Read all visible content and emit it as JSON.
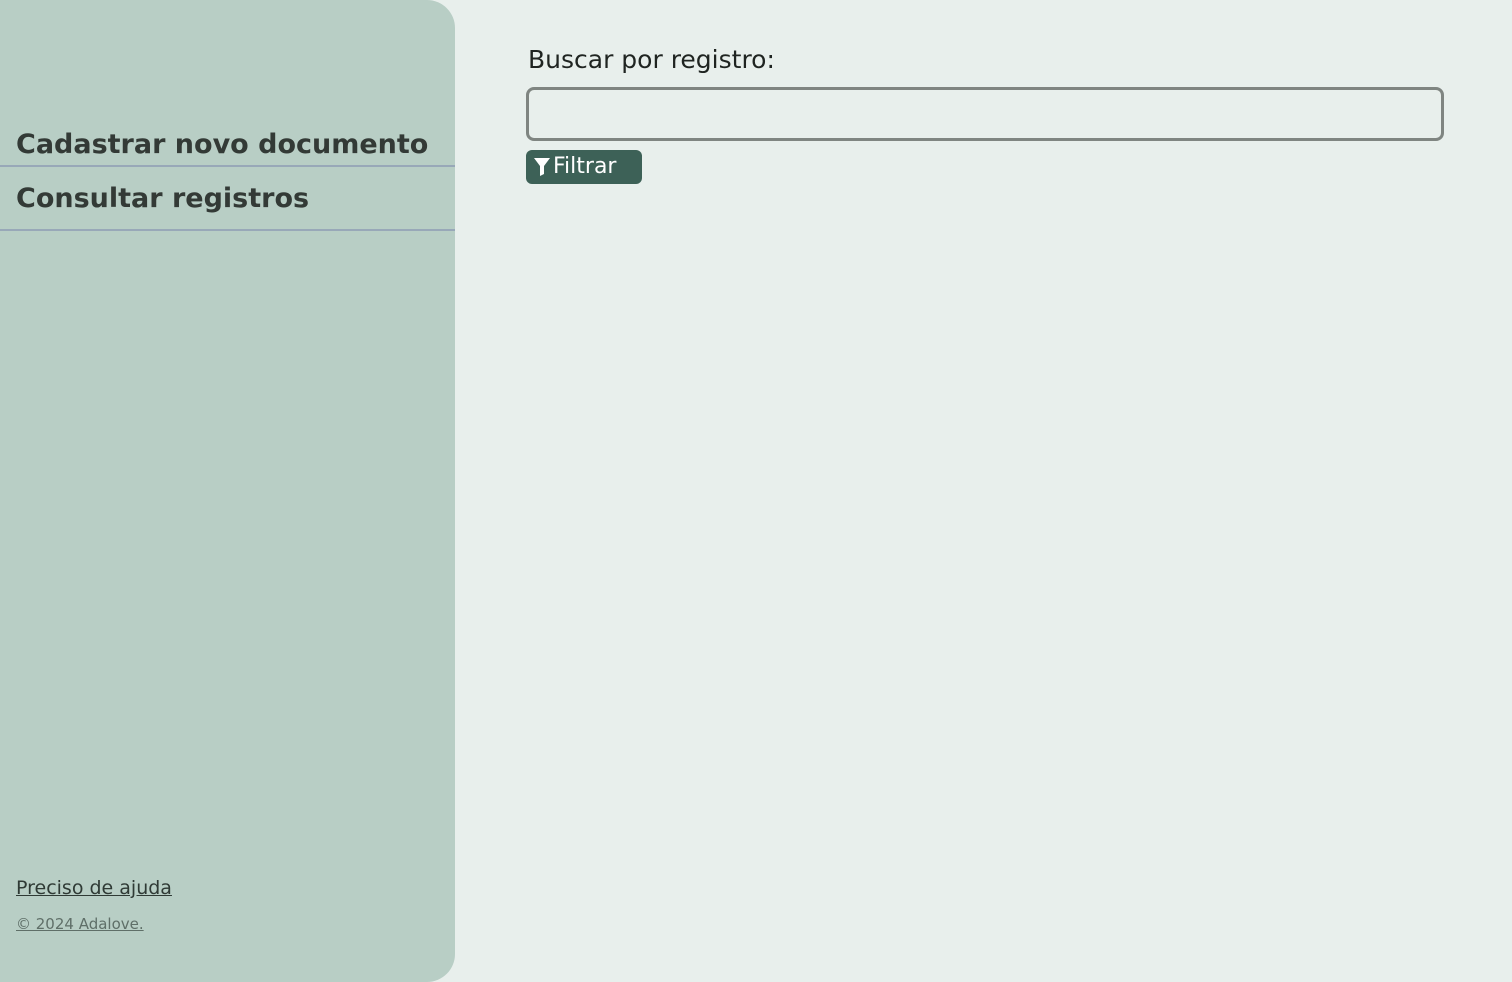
{
  "sidebar": {
    "nav_items": [
      {
        "label": "Cadastrar novo documento"
      },
      {
        "label": "Consultar registros"
      }
    ],
    "help_link": "Preciso de ajuda",
    "copyright": "© 2024 Adalove."
  },
  "main": {
    "search": {
      "label": "Buscar por registro:",
      "value": "",
      "placeholder": ""
    },
    "filter_button": {
      "label": "Filtrar",
      "icon": "filter-icon"
    }
  },
  "colors": {
    "sidebar_bg": "#b8cec5",
    "page_bg": "#e8efec",
    "button_bg": "#3d6157",
    "divider": "#98a8b8"
  }
}
